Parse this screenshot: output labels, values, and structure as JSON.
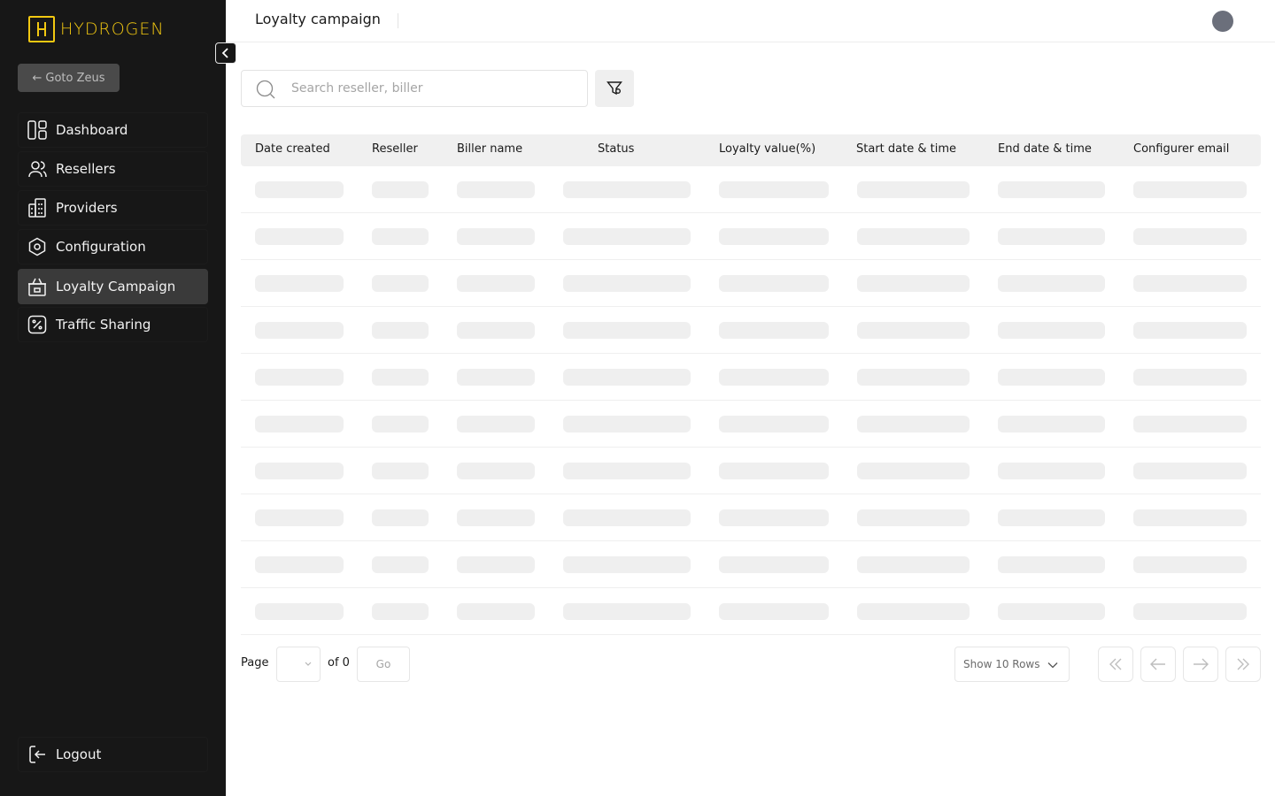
{
  "app": {
    "brand": "HYDROGEN",
    "brand_color": "#f2c811"
  },
  "sidebar": {
    "goto_label": "Goto Zeus",
    "items": [
      {
        "label": "Dashboard",
        "icon": "dashboard-icon"
      },
      {
        "label": "Resellers",
        "icon": "users-icon"
      },
      {
        "label": "Providers",
        "icon": "building-icon"
      },
      {
        "label": "Configuration",
        "icon": "hexagon-settings-icon"
      },
      {
        "label": "Loyalty Campaign",
        "icon": "gift-basket-icon",
        "active": true
      },
      {
        "label": "Traffic Sharing",
        "icon": "percent-icon"
      }
    ],
    "logout_label": "Logout"
  },
  "header": {
    "title": "Loyalty campaign"
  },
  "search": {
    "placeholder": "Search reseller, biller"
  },
  "table": {
    "columns": [
      "Date created",
      "Reseller",
      "Biller name",
      "Status",
      "Loyalty value(%)",
      "Start date & time",
      "End date & time",
      "Configurer email"
    ],
    "loading_rows": 10
  },
  "pagination": {
    "page_label": "Page",
    "of_label": "of 0",
    "go_label": "Go",
    "rows_label": "Show 10 Rows"
  }
}
